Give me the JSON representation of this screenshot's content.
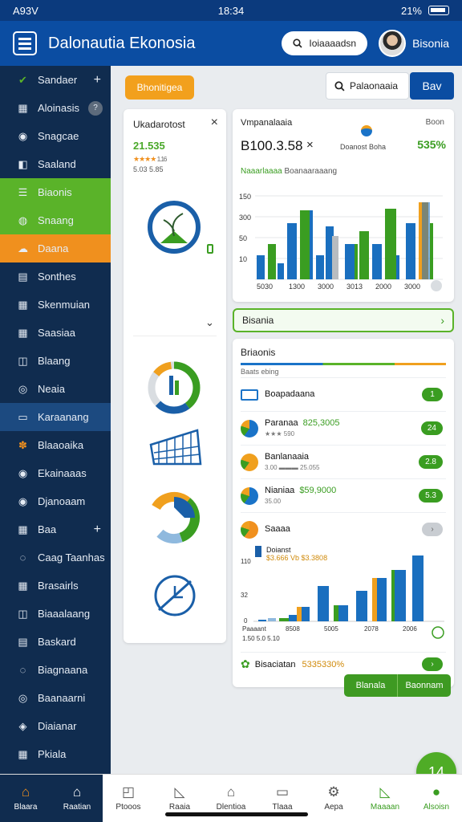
{
  "status": {
    "left": "A93V",
    "time": "18:34",
    "battery": "21%"
  },
  "app": {
    "title": "Dalonautia Ekonosia",
    "search_pill": "Ioiaaaadsn",
    "user_name": "Bisonia"
  },
  "sidebar": {
    "items": [
      {
        "label": "Sandaer",
        "icon": "check-icon",
        "plus": "+"
      },
      {
        "label": "Aloinasis",
        "icon": "grid-icon",
        "badge": "?"
      },
      {
        "label": "Snagcae",
        "icon": "chat-icon"
      },
      {
        "label": "Saaland",
        "icon": "tag-icon"
      },
      {
        "label": "Biaonis",
        "icon": "list-icon"
      },
      {
        "label": "Snaang",
        "icon": "globe-icon"
      },
      {
        "label": "Daana",
        "icon": "cloud-icon"
      },
      {
        "label": "Sonthes",
        "icon": "doc-icon"
      },
      {
        "label": "Skenmuian",
        "icon": "table-icon"
      },
      {
        "label": "Saasiaa",
        "icon": "table-icon"
      },
      {
        "label": "Blaang",
        "icon": "box-icon"
      },
      {
        "label": "Neaia",
        "icon": "circle-icon"
      },
      {
        "label": "Karaanang",
        "icon": "calendar-icon"
      },
      {
        "label": "Blaaoaika",
        "icon": "flower-icon"
      },
      {
        "label": "Ekainaaas",
        "icon": "chat-icon"
      },
      {
        "label": "Djanoaam",
        "icon": "chat-icon"
      },
      {
        "label": "Baa",
        "icon": "table-icon",
        "plus": "+"
      },
      {
        "label": "Caag Taanhas",
        "icon": "ring-icon"
      },
      {
        "label": "Brasairls",
        "icon": "table-icon"
      },
      {
        "label": "Biaaalaang",
        "icon": "box-icon"
      },
      {
        "label": "Baskard",
        "icon": "doc-icon"
      },
      {
        "label": "Biagnaana",
        "icon": "ring-icon"
      },
      {
        "label": "Baanaarni",
        "icon": "circle-icon"
      },
      {
        "label": "Diaianar",
        "icon": "lock-icon"
      },
      {
        "label": "Pkiala",
        "icon": "table-icon"
      }
    ]
  },
  "toolbar": {
    "orange_button": "Bhonitigea",
    "search_text": "Palaonaaia",
    "blue_button": "Bav"
  },
  "left_card": {
    "title": "Ukadarotost",
    "value": "21.535",
    "stars": "★★★★",
    "stars_text": "1.16",
    "sub": "5.03 5.85",
    "expand_icon": "chevron-down-icon"
  },
  "right_card": {
    "title": "Vmpanalaaia",
    "right_label": "Boon",
    "big_value": "B100.3.58",
    "small": "Doanost Boha",
    "percent": "535%",
    "legend_a": "Naaarlaaaa",
    "legend_b": "Boanaaraaang"
  },
  "bar_chart_1": {
    "ylabels": [
      "150",
      "300",
      "50",
      "10"
    ],
    "xlabels": [
      "5030",
      "1300",
      "3000",
      "3013",
      "2000",
      "3000"
    ]
  },
  "green_row": {
    "label": "Bisania",
    "chevron": "›"
  },
  "list_card": {
    "title": "Briaonis",
    "sub": "Baats ebing",
    "rows": [
      {
        "label": "Boapadaana",
        "amount": "",
        "sub": "",
        "tag": "1",
        "grey": false,
        "icon_color": "#1a73c8"
      },
      {
        "label": "Paranaa",
        "amount": "825,3005",
        "sub": "★★★ 590",
        "tag": "24",
        "grey": false,
        "icon_color": "#1a73c8"
      },
      {
        "label": "Banlanaaia",
        "amount": "",
        "sub": "3.00 ▬▬▬ 25.055",
        "tag": "2.8",
        "grey": false,
        "icon_color": "#f0a01e"
      },
      {
        "label": "Nianiaa",
        "amount": "$59,9000",
        "sub": "35.00",
        "tag": "5.3",
        "grey": false,
        "icon_color": "#1a73c8"
      },
      {
        "label": "Saaaa",
        "amount": "",
        "sub": "",
        "tag": "›",
        "grey": true,
        "icon_color": "#f0901e"
      }
    ],
    "bottom_label": "Bisaciatan",
    "bottom_amount": "5335330%",
    "bottom_tag": "›"
  },
  "bar_chart_2": {
    "title": "Doianst",
    "subtitle": "$3.666 Vb $3.3808",
    "ylabels": [
      "110",
      "32",
      "0"
    ],
    "xlabels": [
      "Paaaant",
      "8508",
      "5005",
      "2078",
      "2006"
    ],
    "x_sub": "1.50 5.0 5.10"
  },
  "footer_buttons": {
    "left": "Blanala",
    "right": "Baonnam"
  },
  "fab": {
    "label": "14"
  },
  "bottom_nav": [
    {
      "label": "Blaara",
      "icon": "home-icon"
    },
    {
      "label": "Raatian",
      "icon": "house-icon"
    },
    {
      "label": "Ptooos",
      "icon": "bag-icon"
    },
    {
      "label": "Raaia",
      "icon": "chart-icon"
    },
    {
      "label": "Dlentioa",
      "icon": "house-icon"
    },
    {
      "label": "Tlaaa",
      "icon": "calendar-icon"
    },
    {
      "label": "Aepa",
      "icon": "gear-icon"
    },
    {
      "label": "Maaaan",
      "icon": "chart-icon"
    },
    {
      "label": "Alsoisn",
      "icon": "user-icon"
    }
  ],
  "colors": {
    "primary": "#0b4da2",
    "sidebar": "#102c4f",
    "green": "#5ab329",
    "orange": "#f0901e"
  }
}
